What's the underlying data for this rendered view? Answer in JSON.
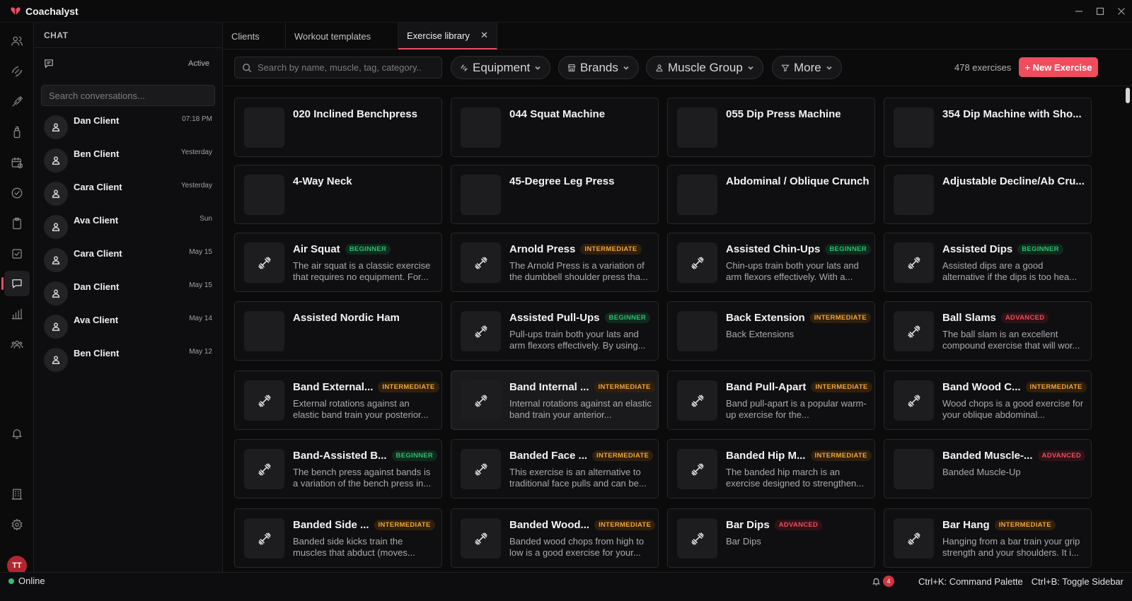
{
  "app": {
    "title": "Coachalyst"
  },
  "chat": {
    "header": "CHAT",
    "filter_label": "Active",
    "search_placeholder": "Search conversations...",
    "conversations": [
      {
        "name": "Dan Client",
        "time": "07:18 PM"
      },
      {
        "name": "Ben Client",
        "time": "Yesterday"
      },
      {
        "name": "Cara Client",
        "time": "Yesterday"
      },
      {
        "name": "Ava Client",
        "time": "Sun"
      },
      {
        "name": "Cara Client",
        "time": "May 15"
      },
      {
        "name": "Dan Client",
        "time": "May 15"
      },
      {
        "name": "Ava Client",
        "time": "May 14"
      },
      {
        "name": "Ben Client",
        "time": "May 12"
      }
    ]
  },
  "user": {
    "initials": "TT"
  },
  "tabs": [
    {
      "label": "Clients"
    },
    {
      "label": "Workout templates"
    },
    {
      "label": "Exercise library"
    }
  ],
  "toolbar": {
    "search_placeholder": "Search by name, muscle, tag, category..",
    "filters": [
      "Equipment",
      "Brands",
      "Muscle Group",
      "More"
    ],
    "count": "478 exercises",
    "new_button": "+ New Exercise"
  },
  "exercises": [
    {
      "title": "020 Inclined Benchpress",
      "level": "",
      "desc": "",
      "icon": ""
    },
    {
      "title": "044 Squat Machine",
      "level": "",
      "desc": "",
      "icon": ""
    },
    {
      "title": "055 Dip Press Machine",
      "level": "",
      "desc": "",
      "icon": ""
    },
    {
      "title": "354 Dip Machine with Sho...",
      "level": "",
      "desc": "",
      "icon": ""
    },
    {
      "title": "4-Way Neck",
      "level": "",
      "desc": "",
      "icon": ""
    },
    {
      "title": "45-Degree Leg Press",
      "level": "",
      "desc": "",
      "icon": ""
    },
    {
      "title": "Abdominal / Oblique Crunch",
      "level": "",
      "desc": "",
      "icon": ""
    },
    {
      "title": "Adjustable Decline/Ab Cru...",
      "level": "",
      "desc": "",
      "icon": ""
    },
    {
      "title": "Air Squat",
      "level": "BEGINNER",
      "desc": "The air squat is a classic exercise that requires no equipment. For...",
      "icon": "dumbbell-icon"
    },
    {
      "title": "Arnold Press",
      "level": "INTERMEDIATE",
      "desc": "The Arnold Press is a variation of the dumbbell shoulder press tha...",
      "icon": "dumbbell-icon"
    },
    {
      "title": "Assisted Chin-Ups",
      "level": "BEGINNER",
      "desc": "Chin-ups train both your lats and arm flexors effectively. With a...",
      "icon": "dumbbell-icon"
    },
    {
      "title": "Assisted Dips",
      "level": "BEGINNER",
      "desc": "Assisted dips are a good alternative if the dips is too hea...",
      "icon": "dumbbell-icon"
    },
    {
      "title": "Assisted Nordic Ham",
      "level": "",
      "desc": "",
      "icon": ""
    },
    {
      "title": "Assisted Pull-Ups",
      "level": "BEGINNER",
      "desc": "Pull-ups train both your lats and arm flexors effectively. By using...",
      "icon": "dumbbell-icon"
    },
    {
      "title": "Back Extension",
      "level": "INTERMEDIATE",
      "desc": "Back Extensions",
      "icon": ""
    },
    {
      "title": "Ball Slams",
      "level": "ADVANCED",
      "desc": "The ball slam is an excellent compound exercise that will wor...",
      "icon": "dumbbell-icon"
    },
    {
      "title": "Band External...",
      "level": "INTERMEDIATE",
      "desc": "External rotations against an elastic band train your posterior...",
      "icon": "dumbbell-icon"
    },
    {
      "title": "Band Internal ...",
      "level": "INTERMEDIATE",
      "desc": "Internal rotations against an elastic band train your anterior...",
      "icon": "dumbbell-icon"
    },
    {
      "title": "Band Pull-Apart",
      "level": "INTERMEDIATE",
      "desc": "Band pull-apart is a popular warm-up exercise for the...",
      "icon": "dumbbell-icon"
    },
    {
      "title": "Band Wood C...",
      "level": "INTERMEDIATE",
      "desc": "Wood chops is a good exercise for your oblique abdominal...",
      "icon": "dumbbell-icon"
    },
    {
      "title": "Band-Assisted B...",
      "level": "BEGINNER",
      "desc": "The bench press against bands is a variation of the bench press in...",
      "icon": "dumbbell-icon"
    },
    {
      "title": "Banded Face ...",
      "level": "INTERMEDIATE",
      "desc": "This exercise is an alternative to traditional face pulls and can be...",
      "icon": "dumbbell-icon"
    },
    {
      "title": "Banded Hip M...",
      "level": "INTERMEDIATE",
      "desc": "The banded hip march is an exercise designed to strengthen...",
      "icon": "dumbbell-icon"
    },
    {
      "title": "Banded Muscle-...",
      "level": "ADVANCED",
      "desc": "Banded Muscle-Up",
      "icon": ""
    },
    {
      "title": "Banded Side ...",
      "level": "INTERMEDIATE",
      "desc": "Banded side kicks train the muscles that abduct (moves...",
      "icon": "dumbbell-icon"
    },
    {
      "title": "Banded Wood...",
      "level": "INTERMEDIATE",
      "desc": "Banded wood chops from high to low is a good exercise for your...",
      "icon": "dumbbell-icon"
    },
    {
      "title": "Bar Dips",
      "level": "ADVANCED",
      "desc": "Bar Dips",
      "icon": "dumbbell-icon"
    },
    {
      "title": "Bar Hang",
      "level": "INTERMEDIATE",
      "desc": "Hanging from a bar train your grip strength and your shoulders. It i...",
      "icon": "dumbbell-icon"
    }
  ],
  "status": {
    "online": "Online",
    "notifications": "4",
    "shortcut1": "Ctrl+K: Command Palette",
    "shortcut2": "Ctrl+B: Toggle Sidebar"
  },
  "colors": {
    "accent": "#ef4d5e",
    "beginner": "#2fbf71",
    "intermediate": "#f0a43c",
    "advanced": "#ef4d5e"
  }
}
